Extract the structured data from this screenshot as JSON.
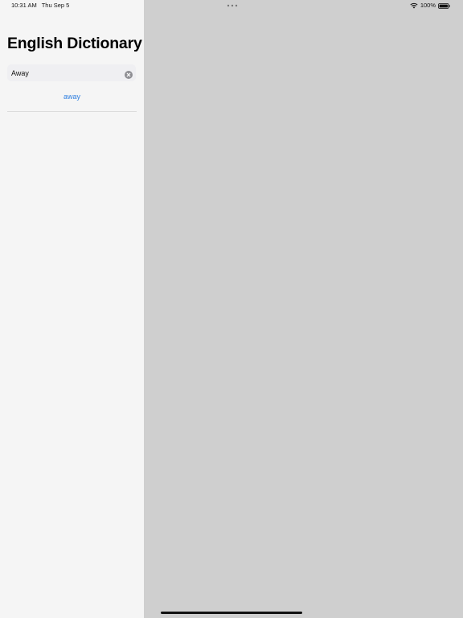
{
  "status_bar": {
    "time": "10:31 AM",
    "date": "Thu Sep 5",
    "battery": "100%"
  },
  "sidebar": {
    "title": "English Dictionary",
    "search": {
      "value": "Away",
      "placeholder": ""
    },
    "results": [
      {
        "label": "away"
      }
    ]
  },
  "icons": {
    "wifi": "wifi-icon",
    "battery": "battery-icon",
    "more": "more-dots-icon",
    "clear": "clear-circle-icon"
  },
  "colors": {
    "accent": "#2f7fe0",
    "sidebar_bg": "#f5f5f5",
    "detail_bg": "#cfcfcf"
  }
}
